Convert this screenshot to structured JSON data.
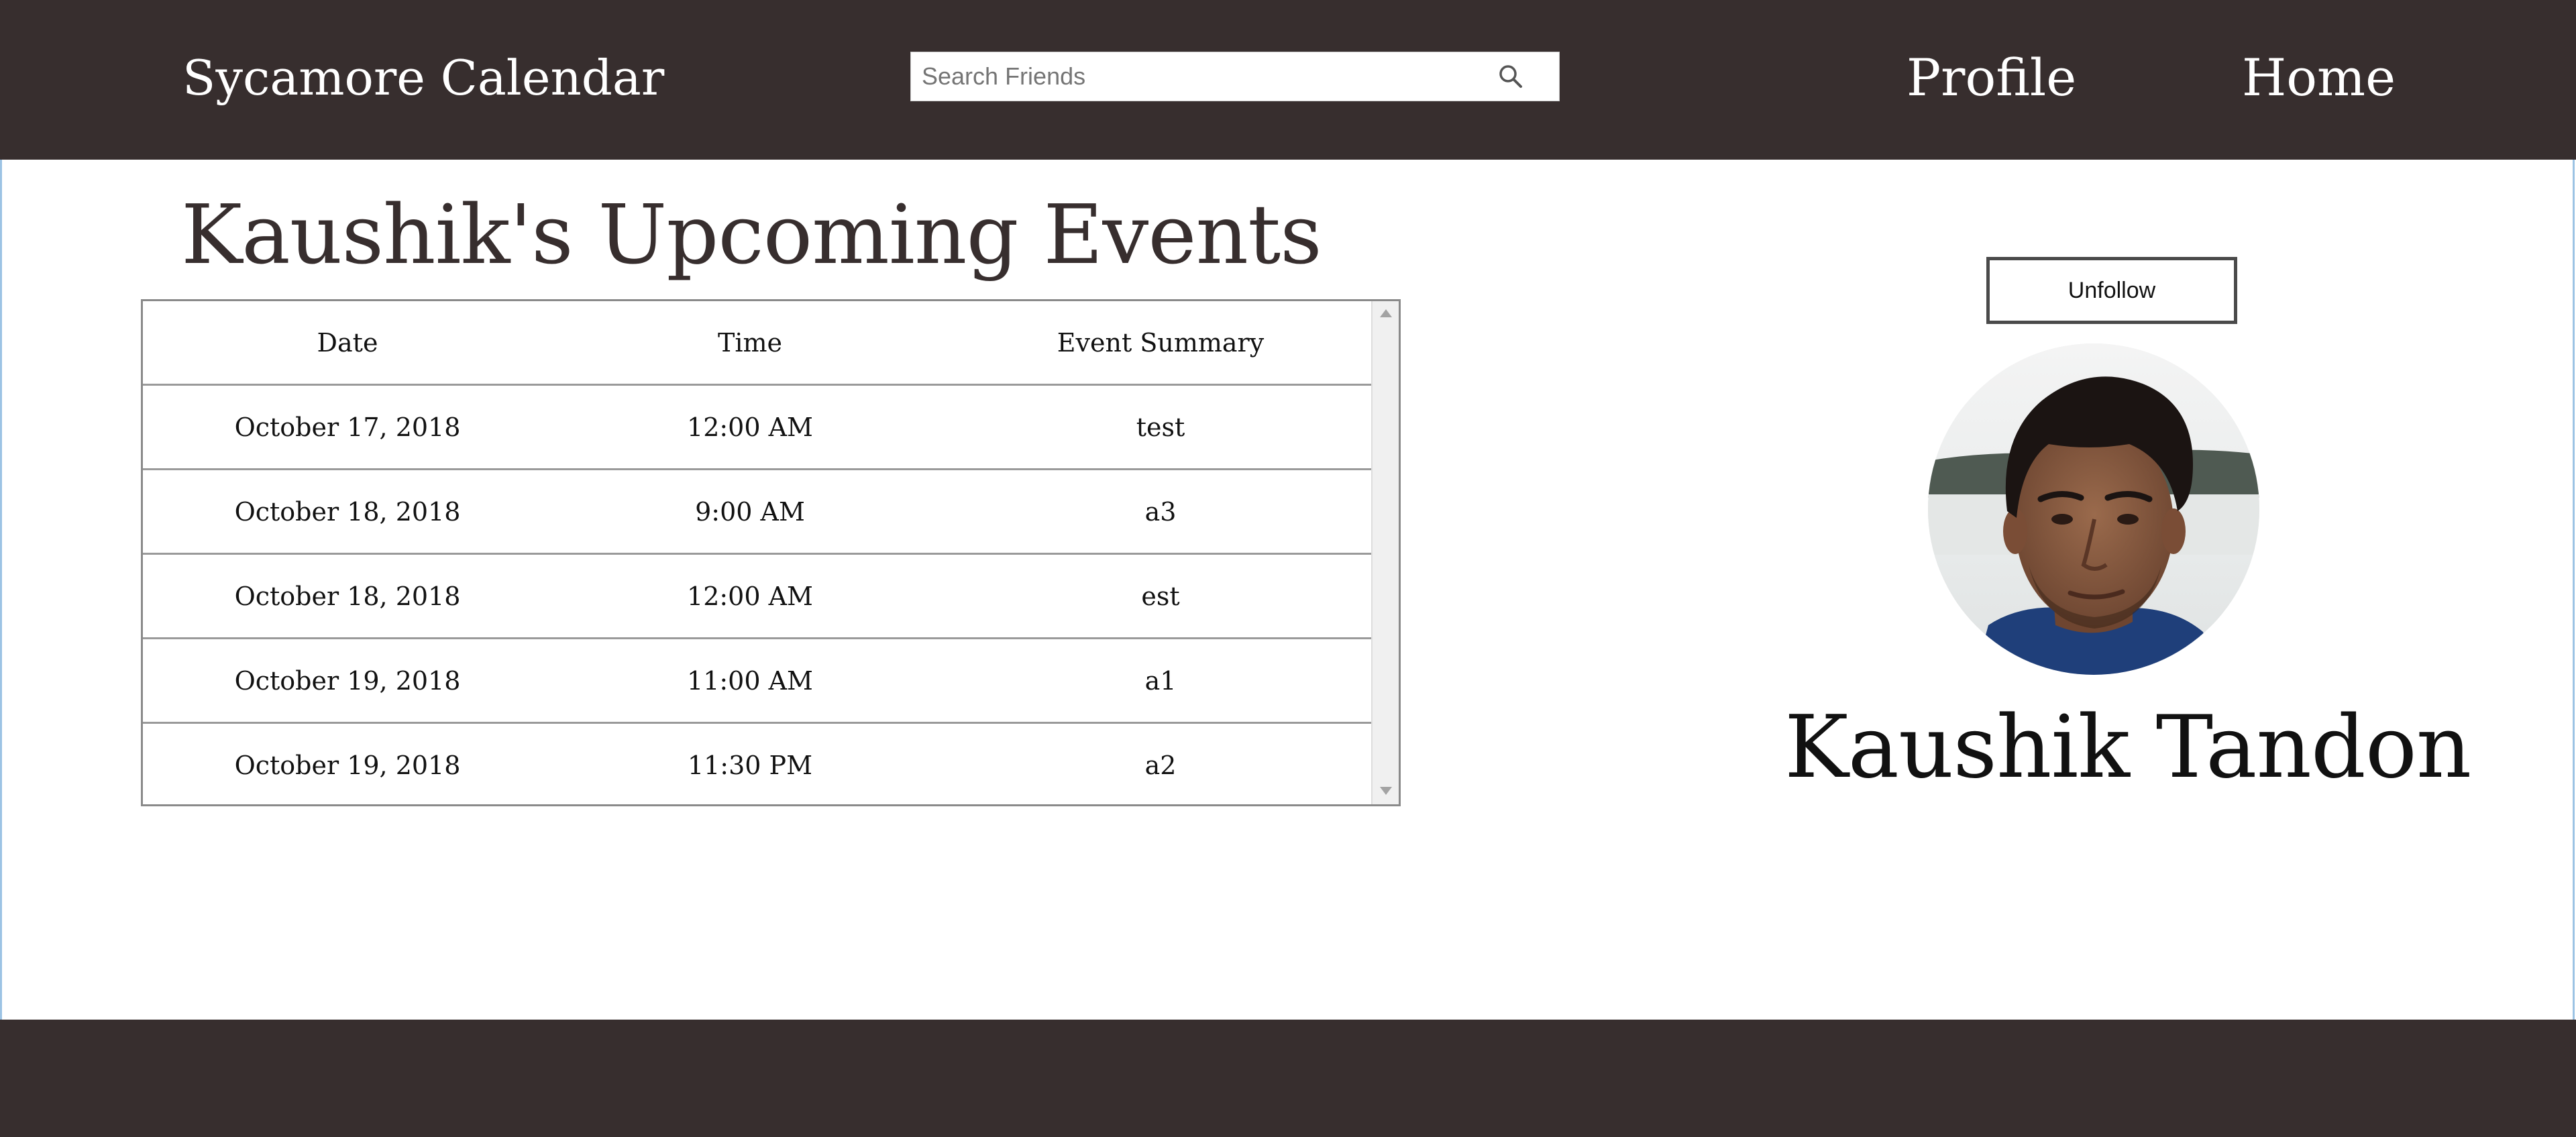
{
  "header": {
    "brand": "Sycamore Calendar",
    "search": {
      "placeholder": "Search Friends",
      "value": "",
      "icon": "search-icon"
    },
    "nav": [
      {
        "label": "Profile"
      },
      {
        "label": "Home"
      }
    ]
  },
  "main": {
    "title": "Kaushik's Upcoming Events",
    "events_table": {
      "columns": [
        "Date",
        "Time",
        "Event Summary"
      ],
      "rows": [
        [
          "October 17, 2018",
          "12:00 AM",
          "test"
        ],
        [
          "October 18, 2018",
          "9:00 AM",
          "a3"
        ],
        [
          "October 18, 2018",
          "12:00 AM",
          "est"
        ],
        [
          "October 19, 2018",
          "11:00 AM",
          "a1"
        ],
        [
          "October 19, 2018",
          "11:30 PM",
          "a2"
        ]
      ]
    }
  },
  "profile": {
    "unfollow_label": "Unfollow",
    "name": "Kaushik Tandon"
  },
  "colors": {
    "header_bg": "#372e2e",
    "footer_bg": "#372e2e",
    "title_text": "#372e2e"
  }
}
